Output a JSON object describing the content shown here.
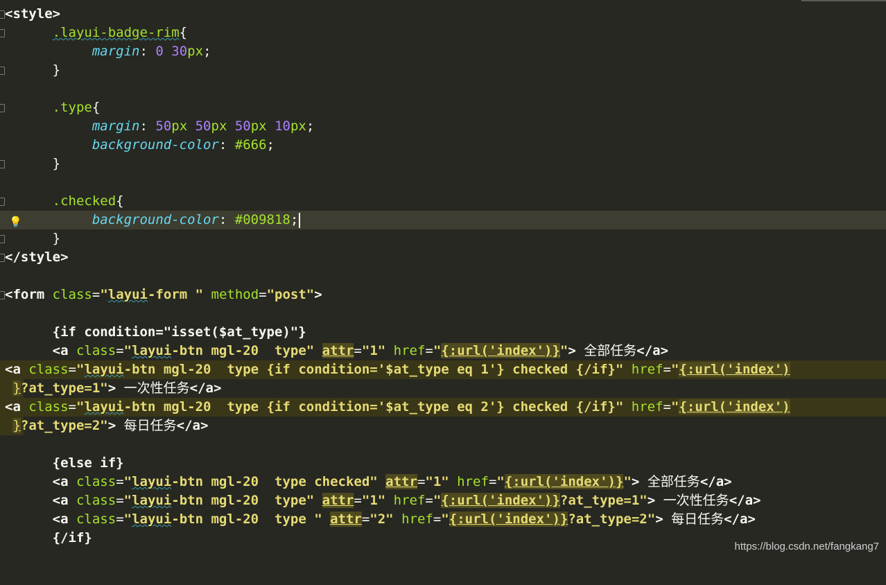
{
  "editor": {
    "style_open": "<style>",
    "style_close": "</style>",
    "rule1_selector": ".layui-badge-rim",
    "rule2_selector": ".type",
    "rule3_selector": ".checked",
    "prop_margin": "margin",
    "prop_bg": "background-color",
    "margin1_value_a": "0",
    "margin1_value_b": "30",
    "unit_px": "px",
    "margin2_a": "50",
    "margin2_b": "50",
    "margin2_c": "50",
    "margin2_d": "10",
    "bg_666": "#666",
    "bg_009818": "#009818",
    "form_line": "<form class=\"layui-form \" method=\"post\">",
    "if_line": "{if condition=\"isset($at_type)\"}",
    "else_line": "{else if}",
    "endif_line": "{/if}",
    "label_all": "全部任务",
    "label_once": "一次性任务",
    "label_daily": "每日任务",
    "url_index": "{:url('index')}",
    "url_index_open": "{:url('index')",
    "url_index_close": "}"
  },
  "watermark": "https://blog.csdn.net/fangkang7"
}
